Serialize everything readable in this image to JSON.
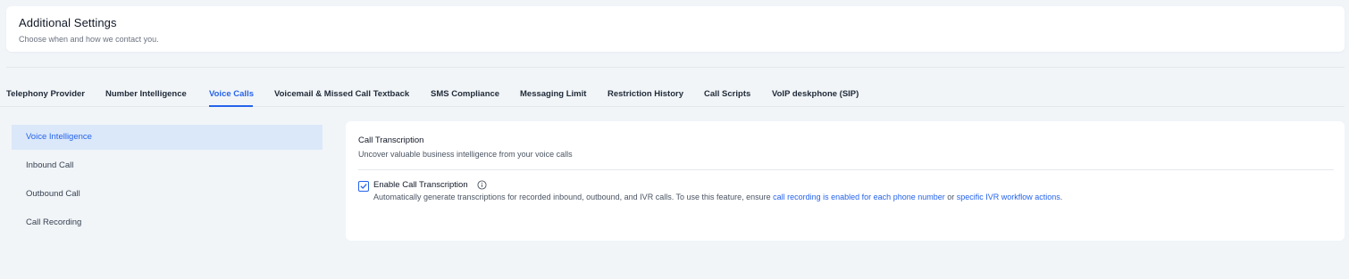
{
  "header": {
    "title": "Additional Settings",
    "subtitle": "Choose when and how we contact you."
  },
  "tabs": [
    {
      "label": "Telephony Provider",
      "active": false
    },
    {
      "label": "Number Intelligence",
      "active": false
    },
    {
      "label": "Voice Calls",
      "active": true
    },
    {
      "label": "Voicemail & Missed Call Textback",
      "active": false
    },
    {
      "label": "SMS Compliance",
      "active": false
    },
    {
      "label": "Messaging Limit",
      "active": false
    },
    {
      "label": "Restriction History",
      "active": false
    },
    {
      "label": "Call Scripts",
      "active": false
    },
    {
      "label": "VoIP deskphone (SIP)",
      "active": false
    }
  ],
  "sidenav": {
    "items": [
      {
        "label": "Voice Intelligence",
        "active": true
      },
      {
        "label": "Inbound Call",
        "active": false
      },
      {
        "label": "Outbound Call",
        "active": false
      },
      {
        "label": "Call Recording",
        "active": false
      }
    ]
  },
  "section": {
    "title": "Call Transcription",
    "subtitle": "Uncover valuable business intelligence from your voice calls",
    "option": {
      "label": "Enable Call Transcription",
      "checked": true,
      "info_icon": "info-circle-icon",
      "desc_prefix": "Automatically generate transcriptions for recorded inbound, outbound, and IVR calls. To use this feature, ensure ",
      "link1": "call recording is enabled for each phone number",
      "desc_mid": " or ",
      "link2": "specific IVR workflow actions",
      "desc_suffix": "."
    }
  },
  "colors": {
    "accent": "#2563eb",
    "active_bg": "#dbe8f9",
    "page_bg": "#f1f5f8"
  }
}
